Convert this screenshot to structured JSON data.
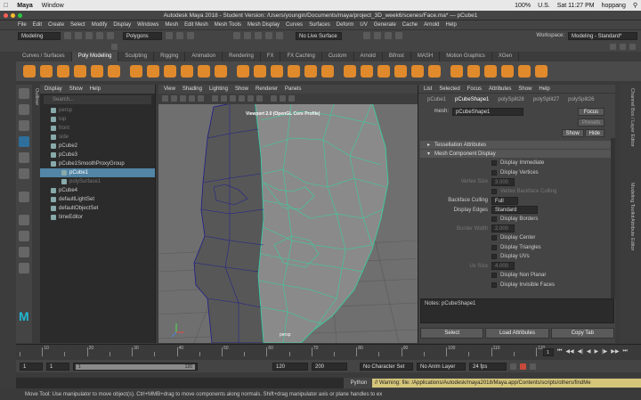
{
  "mac_menu": {
    "app": "Maya",
    "window": "Window",
    "right_flag": "U.S.",
    "clock": "Sat 11:27 PM",
    "user": "hoppang",
    "battery": "100%"
  },
  "titlebar": {
    "title": "Autodesk Maya 2018 - Student Version: /Users/youngin/Documents/maya/project_3D_week6/scenes/Face.ma*  —  pCube1"
  },
  "main_menu": [
    "File",
    "Edit",
    "Create",
    "Select",
    "Modify",
    "Display",
    "Windows",
    "Mesh",
    "Edit Mesh",
    "Mesh Tools",
    "Mesh Display",
    "Curves",
    "Surfaces",
    "Deform",
    "UV",
    "Generate",
    "Cache",
    "Arnold",
    "Help"
  ],
  "status_line": {
    "mode": "Modeling",
    "polygons": "Polygons",
    "live_surface": "No Live Surface",
    "workspace_label": "Workspace:",
    "workspace": "Modeling - Standard*"
  },
  "shelf_tabs": [
    "Curves / Surfaces",
    "Poly Modeling",
    "Sculpting",
    "Rigging",
    "Animation",
    "Rendering",
    "FX",
    "FX Caching",
    "Custom",
    "Arnold",
    "Bifrost",
    "MASH",
    "Motion Graphics",
    "XGen"
  ],
  "shelf_active": "Poly Modeling",
  "shelf_icon_colors": [
    "#e08a2c",
    "#e08a2c",
    "#e08a2c",
    "#e08a2c",
    "#e08a2c",
    "#e08a2c",
    "#e08a2c",
    "#e08a2c",
    "#e08a2c",
    "#e08a2c",
    "#e08a2c",
    "#e08a2c",
    "#e08a2c",
    "#e08a2c",
    "#e08a2c",
    "#e08a2c",
    "#e08a2c",
    "#e08a2c",
    "#e08a2c",
    "#e08a2c",
    "#e08a2c",
    "#e08a2c",
    "#e08a2c",
    "#e08a2c",
    "#e08a2c",
    "#e08a2c",
    "#e08a2c",
    "#e08a2c",
    "#e08a2c",
    "#e08a2c"
  ],
  "outliner": {
    "side_label": "Outliner",
    "menu": [
      "Display",
      "Show",
      "Help"
    ],
    "search_placeholder": "Search...",
    "items": [
      {
        "label": "persp",
        "indent": 1,
        "dim": true
      },
      {
        "label": "top",
        "indent": 1,
        "dim": true
      },
      {
        "label": "front",
        "indent": 1,
        "dim": true
      },
      {
        "label": "side",
        "indent": 1,
        "dim": true
      },
      {
        "label": "pCube2",
        "indent": 1,
        "dim": false
      },
      {
        "label": "pCube3",
        "indent": 1,
        "dim": false
      },
      {
        "label": "pCube1SmoothProxyGroup",
        "indent": 1,
        "dim": false
      },
      {
        "label": "pCube1",
        "indent": 2,
        "dim": false,
        "selected": true
      },
      {
        "label": "polySurface1",
        "indent": 2,
        "dim": true
      },
      {
        "label": "pCube4",
        "indent": 1,
        "dim": false
      },
      {
        "label": "defaultLightSet",
        "indent": 1,
        "dim": false
      },
      {
        "label": "defaultObjectSet",
        "indent": 1,
        "dim": false
      },
      {
        "label": "timeEditor",
        "indent": 1,
        "dim": false
      }
    ]
  },
  "viewport": {
    "menu": [
      "View",
      "Shading",
      "Lighting",
      "Show",
      "Renderer",
      "Panels"
    ],
    "hud_title": "Viewport 2.0 (OpenGL Core Profile)",
    "camera": "persp"
  },
  "channel_box": {
    "menu": [
      "List",
      "Selected",
      "Focus",
      "Attributes",
      "Show",
      "Help"
    ],
    "node_tabs": [
      "pCube1",
      "pCubeShape1",
      "polySplit28",
      "polySplit27",
      "polySplit26"
    ],
    "active_tab": "pCubeShape1",
    "mesh_label": "mesh:",
    "mesh_value": "pCubeShape1",
    "focus": "Focus",
    "presets": "Presets",
    "show": "Show",
    "hide": "Hide",
    "sections": [
      "Tessellation Attributes",
      "Mesh Component Display"
    ],
    "attrs": [
      {
        "left": "",
        "right": "Display Immediate",
        "cb": true
      },
      {
        "left": "",
        "right": "Display Vertices",
        "cb": true
      },
      {
        "left": "Vertex Size",
        "right": "3.000",
        "dim": true
      },
      {
        "left": "",
        "right": "Vertex Backface Culling",
        "cb": true,
        "dim": true
      },
      {
        "left": "Backface Culling",
        "right": "Full",
        "dd": true
      },
      {
        "left": "Display Edges",
        "right": "Standard",
        "dd": true
      },
      {
        "left": "",
        "right": "Display Borders",
        "cb": true
      },
      {
        "left": "Border Width",
        "right": "2.000",
        "dim": true
      },
      {
        "left": "",
        "right": "Display Center",
        "cb": true
      },
      {
        "left": "",
        "right": "Display Triangles",
        "cb": true
      },
      {
        "left": "",
        "right": "Display UVs",
        "cb": true
      },
      {
        "left": "Uv Size",
        "right": "4.000",
        "dim": true
      },
      {
        "left": "",
        "right": "Display Non Planar",
        "cb": true
      },
      {
        "left": "",
        "right": "Display Invisible Faces",
        "cb": true
      }
    ],
    "notes_label": "Notes:  pCubeShape1",
    "bottom_buttons": [
      "Select",
      "Load Attributes",
      "Copy Tab"
    ]
  },
  "side_tabs": [
    "Channel Box / Layer Editor",
    "Modeling Toolkit",
    "Attribute Editor"
  ],
  "timeline": {
    "ticks": [
      "",
      "10",
      "",
      "20",
      "",
      "30",
      "",
      "40",
      "",
      "50",
      "",
      "60",
      "",
      "70",
      "",
      "80",
      "",
      "90",
      "",
      "100",
      "",
      "110",
      "",
      "120"
    ],
    "current": "1"
  },
  "range": {
    "start": "1",
    "start2": "1",
    "slider_start": "1",
    "slider_end": "120",
    "end2": "120",
    "end": "200",
    "character_set": "No Character Set",
    "anim_layer": "No Anim Layer",
    "fps": "24 fps"
  },
  "command_line": {
    "language": "MEL",
    "python": "Python",
    "warning": "// Warning: file: /Applications/Autodesk/maya2018/Maya.app/Contents/scripts/others/findMe"
  },
  "help_line": "Move Tool: Use manipulator to move object(s). Ctrl+MMB+drag to move components along normals. Shift+drag manipulator axis or plane handles to ex"
}
